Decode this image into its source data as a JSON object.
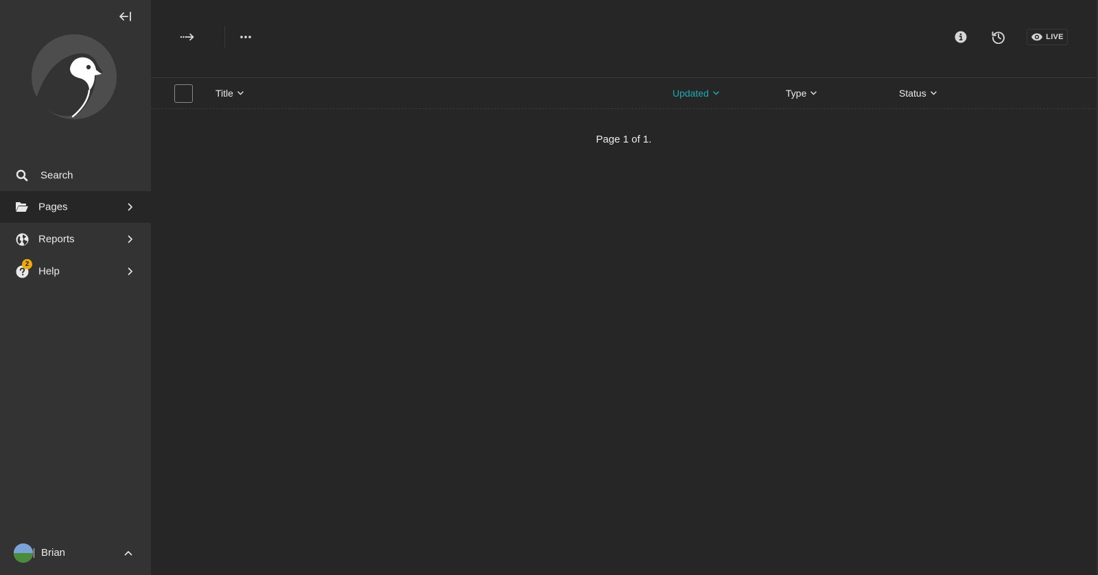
{
  "sidebar": {
    "items": [
      {
        "label": "Search",
        "icon": "search-icon"
      },
      {
        "label": "Pages",
        "icon": "folder-open-icon",
        "active": true
      },
      {
        "label": "Reports",
        "icon": "globe-icon"
      },
      {
        "label": "Help",
        "icon": "help-circle-icon",
        "badge": "2"
      }
    ],
    "account": {
      "name": "Brian"
    }
  },
  "header": {
    "live_label": "LIVE"
  },
  "table": {
    "columns": [
      {
        "label": "Title",
        "sorted": false
      },
      {
        "label": "Updated",
        "sorted": true
      },
      {
        "label": "Type",
        "sorted": false
      },
      {
        "label": "Status",
        "sorted": false
      }
    ]
  },
  "pagination": {
    "text": "Page 1 of 1."
  },
  "colors": {
    "sidebar_bg": "#333333",
    "main_bg": "#262626",
    "accent": "#1eaab3",
    "badge": "#f1a90e"
  }
}
